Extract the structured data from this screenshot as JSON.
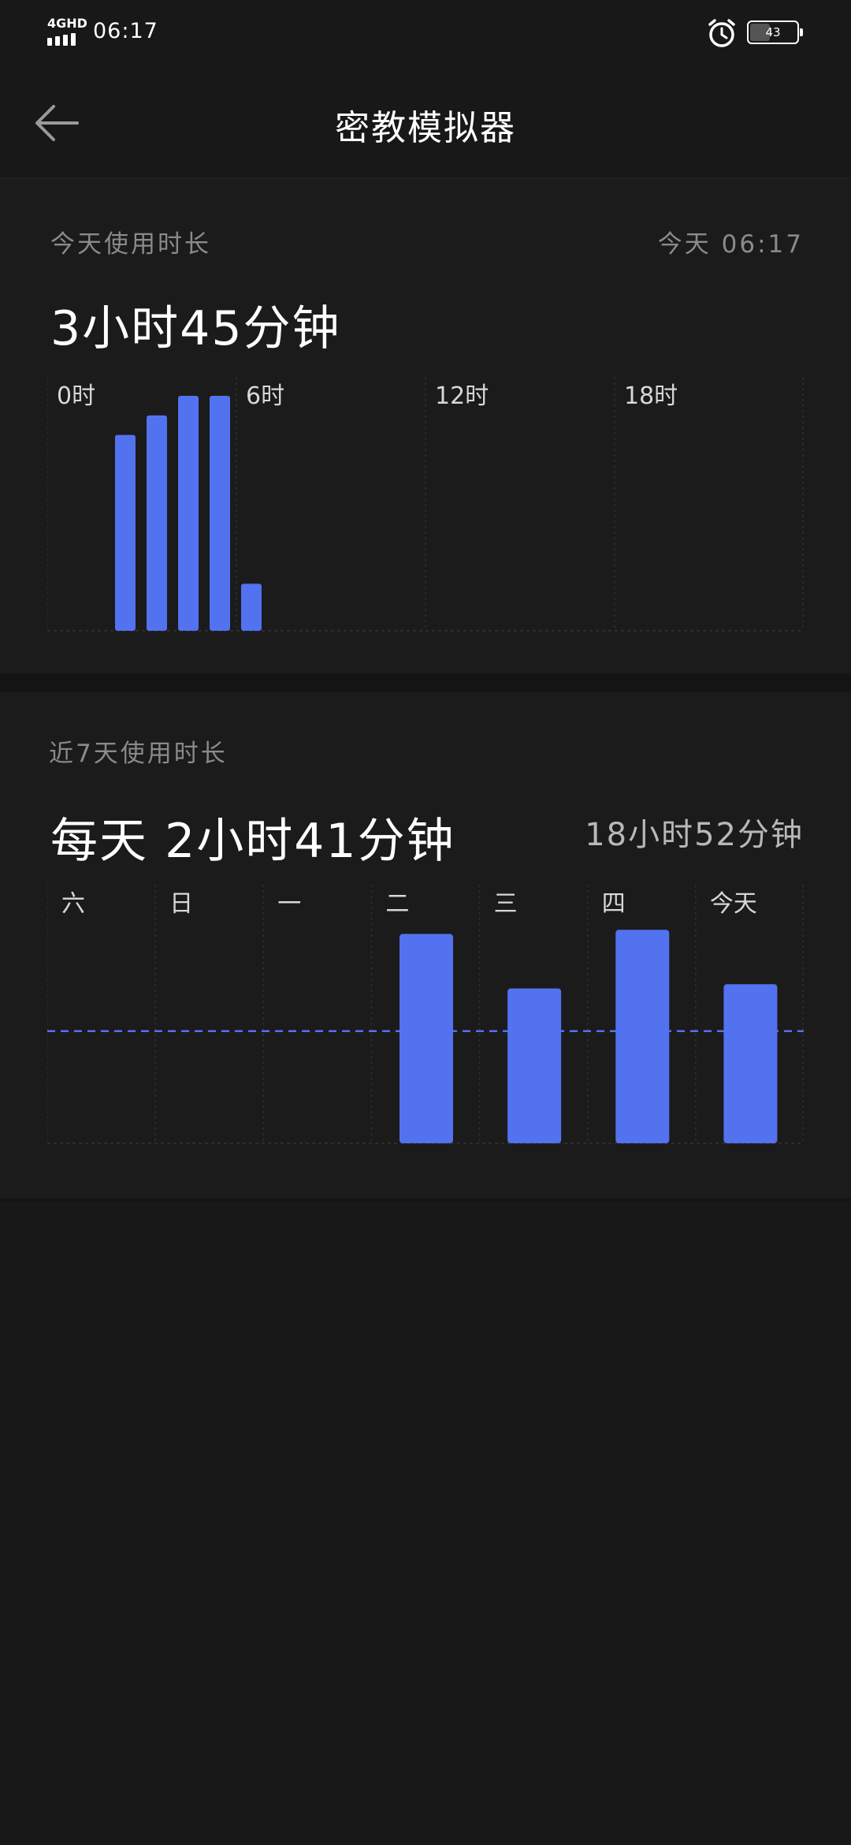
{
  "status_bar": {
    "network": "4GHD",
    "time": "06:17",
    "battery": "43"
  },
  "header": {
    "title": "密教模拟器"
  },
  "today_card": {
    "label": "今天使用时长",
    "date": "今天 06:17",
    "total": "3小时45分钟"
  },
  "week_card": {
    "label": "近7天使用时长",
    "daily_avg": "每天 2小时41分钟",
    "total": "18小时52分钟"
  },
  "colors": {
    "bar": "#5372F0",
    "background": "#181818",
    "card": "#1b1b1b",
    "muted_text": "#8a8a8a"
  },
  "chart_data": [
    {
      "type": "bar",
      "title": "",
      "x_tick_labels": [
        "0时",
        "6时",
        "12时",
        "18时"
      ],
      "x": [
        2,
        3,
        4,
        5,
        6
      ],
      "xlim": [
        0,
        24
      ],
      "values": [
        50,
        55,
        60,
        60,
        12
      ],
      "ylabel": "",
      "ylim": [
        0,
        60
      ],
      "grid": true
    },
    {
      "type": "bar",
      "title": "",
      "categories": [
        "六",
        "日",
        "一",
        "二",
        "三",
        "四",
        "今天"
      ],
      "values": [
        0,
        0,
        0,
        5.0,
        3.7,
        5.1,
        3.8
      ],
      "average": 2.68,
      "ylim": [
        0,
        5.5
      ],
      "grid": true,
      "average_line": "dashed"
    }
  ]
}
